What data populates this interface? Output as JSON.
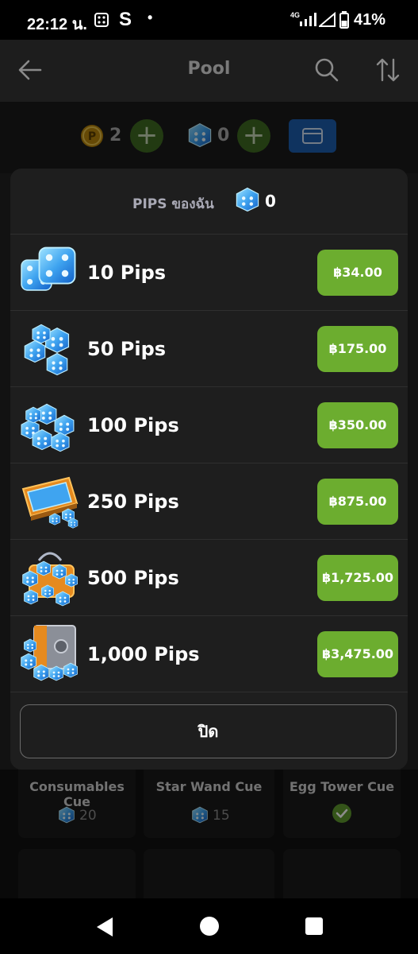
{
  "status_bar": {
    "time": "22:12 น.",
    "carrier_letter": "S",
    "dot": "•",
    "network": "4G",
    "battery": "41%"
  },
  "header": {
    "title": "Pool",
    "back_icon": "arrow-left-icon",
    "search_icon": "search-icon",
    "sort_icon": "sort-icon"
  },
  "balance_bar": {
    "coins": "2",
    "pips": "0",
    "coin_icon": "coin-icon",
    "pips_icon": "dice-icon",
    "wallet_icon": "wallet-icon"
  },
  "modal": {
    "heading": "PIPS ของฉัน",
    "balance": "0",
    "packages": [
      {
        "label": "10 Pips",
        "price": "฿34.00"
      },
      {
        "label": "50 Pips",
        "price": "฿175.00"
      },
      {
        "label": "100 Pips",
        "price": "฿350.00"
      },
      {
        "label": "250 Pips",
        "price": "฿875.00"
      },
      {
        "label": "500 Pips",
        "price": "฿1,725.00"
      },
      {
        "label": "1,000 Pips",
        "price": "฿3,475.00"
      }
    ],
    "close_label": "ปิด"
  },
  "background_cards": [
    {
      "name": "Consumables Cue",
      "cost": "20"
    },
    {
      "name": "Star Wand Cue",
      "cost": "15"
    },
    {
      "name": "Egg Tower Cue",
      "owned": true
    }
  ],
  "colors": {
    "accent_green": "#6cad2f",
    "dice_blue": "#3fa4f0",
    "wallet_blue": "#1d5dae"
  }
}
